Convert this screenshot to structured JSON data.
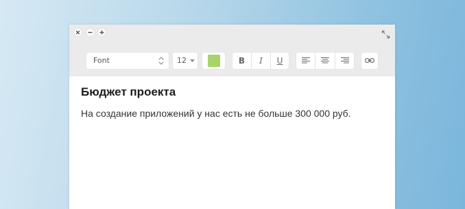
{
  "toolbar": {
    "font_label": "Font",
    "size_label": "12",
    "text_color": "#a9d46a",
    "bold_label": "B",
    "italic_label": "I",
    "underline_label": "U"
  },
  "document": {
    "title": "Бюджет проекта",
    "body": "На создание приложений у нас есть не больше 300 000 руб."
  },
  "icons": {
    "close": "close-icon",
    "minimize": "minimize-icon",
    "maximize": "plus-icon",
    "expand": "expand-icon",
    "font_stepper": "updown-chevron-icon",
    "size_dropdown": "caret-down-icon",
    "align_left": "align-left-icon",
    "align_center": "align-center-icon",
    "align_right": "align-right-icon",
    "link": "link-icon"
  }
}
